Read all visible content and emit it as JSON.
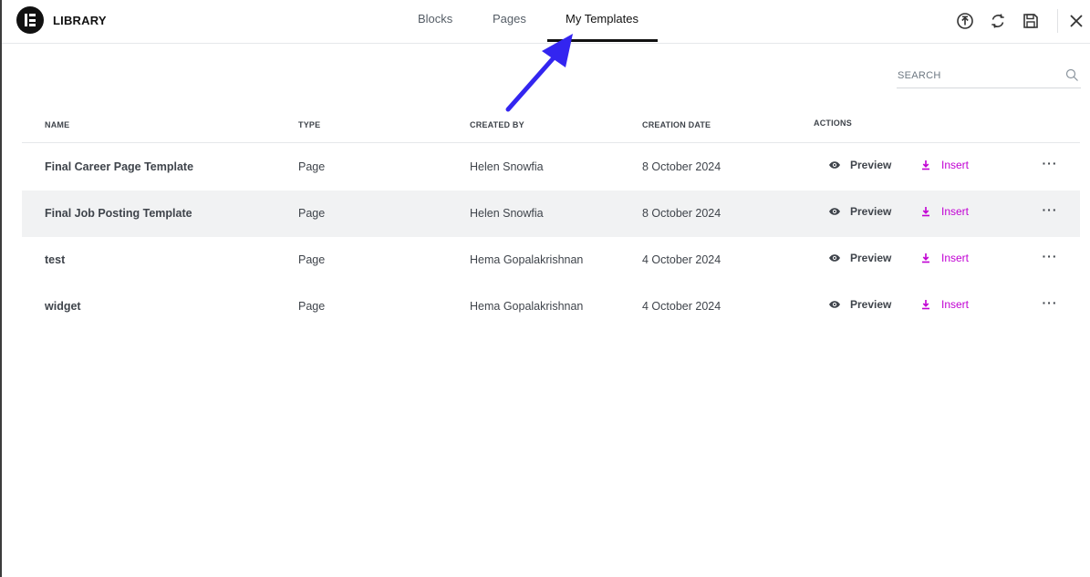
{
  "app": {
    "brand": "LIBRARY"
  },
  "tabs": [
    {
      "label": "Blocks",
      "active": false
    },
    {
      "label": "Pages",
      "active": false
    },
    {
      "label": "My Templates",
      "active": true
    }
  ],
  "header_icons": [
    "upload-icon",
    "sync-icon",
    "save-icon",
    "close-icon"
  ],
  "search": {
    "placeholder": "SEARCH"
  },
  "table": {
    "columns": [
      "NAME",
      "TYPE",
      "CREATED BY",
      "CREATION DATE",
      "ACTIONS"
    ],
    "rows": [
      {
        "name": "Final Career Page Template",
        "type": "Page",
        "created_by": "Helen Snowfia",
        "date": "8 October 2024",
        "preview": "Preview",
        "insert": "Insert"
      },
      {
        "name": "Final Job Posting Template",
        "type": "Page",
        "created_by": "Helen Snowfia",
        "date": "8 October 2024",
        "preview": "Preview",
        "insert": "Insert"
      },
      {
        "name": "test",
        "type": "Page",
        "created_by": "Hema Gopalakrishnan",
        "date": "4 October 2024",
        "preview": "Preview",
        "insert": "Insert"
      },
      {
        "name": "widget",
        "type": "Page",
        "created_by": "Hema Gopalakrishnan",
        "date": "4 October 2024",
        "preview": "Preview",
        "insert": "Insert"
      }
    ],
    "more_glyph": "···"
  },
  "colors": {
    "accent": "#c100d3",
    "annotation_arrow": "#3325f0",
    "hover_row": "#f1f2f3"
  }
}
